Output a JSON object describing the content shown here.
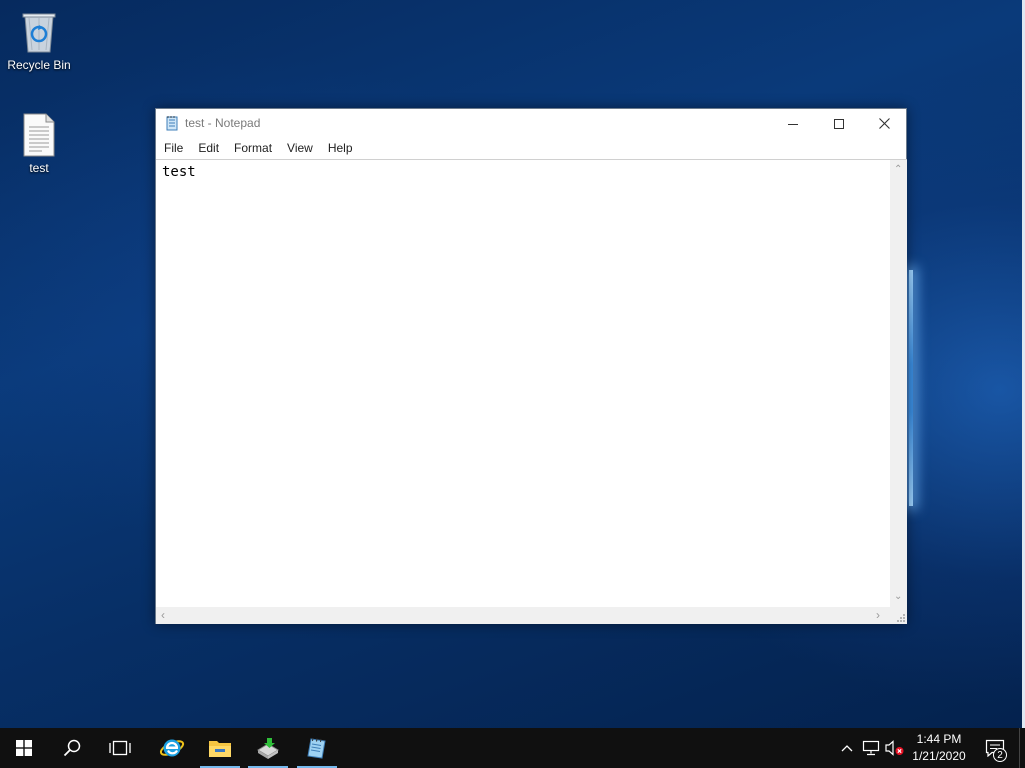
{
  "desktop": {
    "icons": [
      {
        "label": "Recycle Bin",
        "icon": "recycle-bin-icon"
      },
      {
        "label": "test",
        "icon": "text-file-icon"
      }
    ]
  },
  "window": {
    "title": "test - Notepad",
    "app_icon": "notepad-icon",
    "controls": {
      "minimize": "minimize-icon",
      "maximize": "maximize-icon",
      "close": "close-icon"
    },
    "menu": [
      {
        "label": "File"
      },
      {
        "label": "Edit"
      },
      {
        "label": "Format"
      },
      {
        "label": "View"
      },
      {
        "label": "Help"
      }
    ],
    "content": "test"
  },
  "taskbar": {
    "start": "windows-logo-icon",
    "search": "search-icon",
    "task_view": "task-view-icon",
    "pinned": [
      {
        "name": "internet-explorer-icon"
      },
      {
        "name": "file-explorer-icon"
      },
      {
        "name": "server-manager-icon"
      },
      {
        "name": "notepad-icon"
      }
    ],
    "tray": {
      "chevron": "chevron-up-icon",
      "network": "network-icon",
      "volume": "volume-muted-icon"
    },
    "clock": {
      "time": "1:44 PM",
      "date": "1/21/2020"
    },
    "notifications": {
      "icon": "action-center-icon",
      "count": "2"
    }
  },
  "colors": {
    "accent": "#76b9ed",
    "taskbar": "#101010",
    "desktop": "#0a3a7a"
  }
}
